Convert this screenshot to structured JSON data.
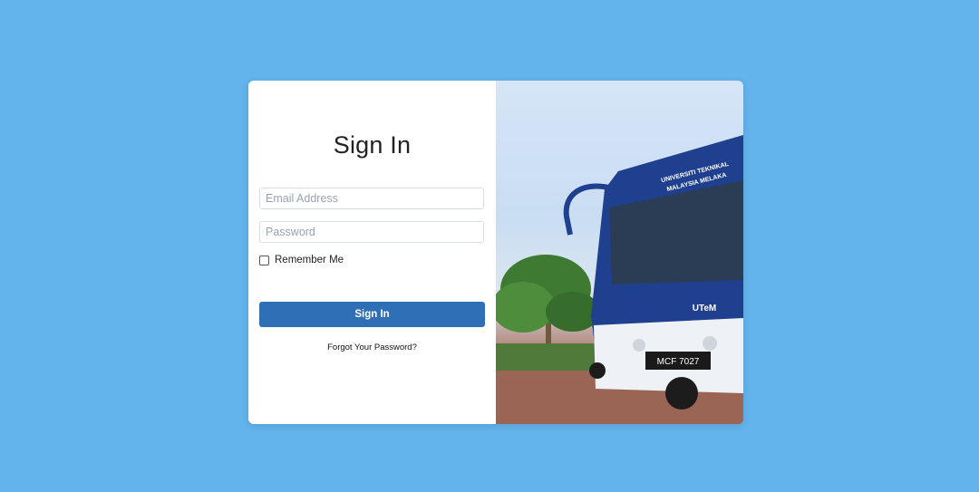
{
  "login": {
    "title": "Sign In",
    "email_placeholder": "Email Address",
    "password_placeholder": "Password",
    "remember_label": "Remember Me",
    "submit_label": "Sign In",
    "forgot_label": "Forgot Your Password?"
  },
  "photo": {
    "bus_banner_line1": "UNIVERSITI TEKNIKAL",
    "bus_banner_line2": "MALAYSIA MELAKA",
    "logo_text": "UTeM",
    "plate": "MCF 7027"
  },
  "colors": {
    "background": "#63b3ec",
    "button": "#2f6fb5",
    "bus_blue": "#1f3f8f"
  }
}
